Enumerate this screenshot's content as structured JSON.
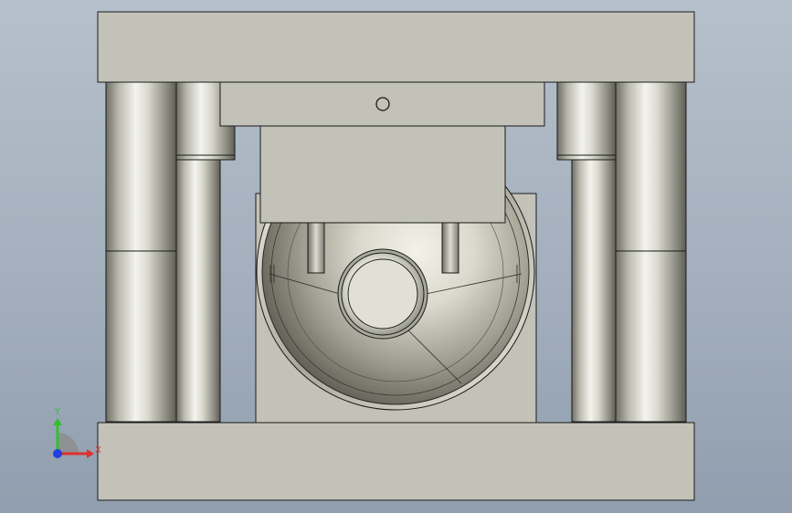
{
  "viewport": {
    "background_top": "#b6c0cc",
    "background_bottom": "#909eaf"
  },
  "model": {
    "plate_color": "#c2c2b8",
    "edge_color": "#1a1a1a",
    "pillar_color": "#c8c8be",
    "parts": [
      "top-plate",
      "bottom-plate",
      "guide-pillar-left-outer",
      "guide-pillar-left-inner",
      "guide-pillar-right-inner",
      "guide-pillar-right-outer",
      "upper-die-block",
      "punch-holder",
      "lower-die-block",
      "bowl-cavity",
      "center-punch"
    ]
  },
  "triad": {
    "x_label": "X",
    "y_label": "Y",
    "x_color": "#e03030",
    "y_color": "#30c030",
    "z_color": "#2040e0"
  }
}
